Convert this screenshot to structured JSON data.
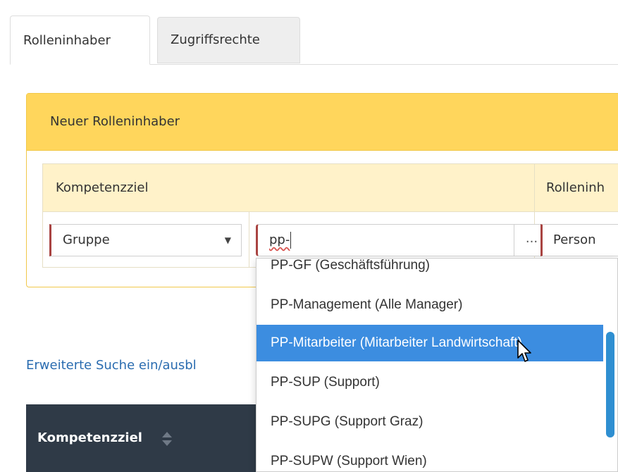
{
  "tabs": [
    {
      "label": "Rolleninhaber",
      "active": true
    },
    {
      "label": "Zugriffsrechte",
      "active": false
    }
  ],
  "panel": {
    "heading": "Neuer Rolleninhaber",
    "columns": [
      "Kompetenzziel",
      "Rolleninh"
    ],
    "row": {
      "type_select": "Gruppe",
      "search_value": "pp-",
      "browse_button": "...",
      "holder_select": "Person"
    }
  },
  "dropdown": {
    "options": [
      "PP-GF (Geschäftsführung)",
      "PP-Management (Alle Manager)",
      "PP-Mitarbeiter (Mitarbeiter Landwirtschaft)",
      "PP-SUP (Support)",
      "PP-SUPG (Support Graz)",
      "PP-SUPW (Support Wien)"
    ],
    "selected_index": 2
  },
  "advanced_search_link": "Erweiterte Suche ein/ausbl",
  "results_table": {
    "header": "Kompetenzziel"
  },
  "colors": {
    "panel_heading": "#ffd65c",
    "selected_option": "#3c8de0",
    "dark_header": "#2f3a47",
    "link": "#2a6cb0"
  }
}
